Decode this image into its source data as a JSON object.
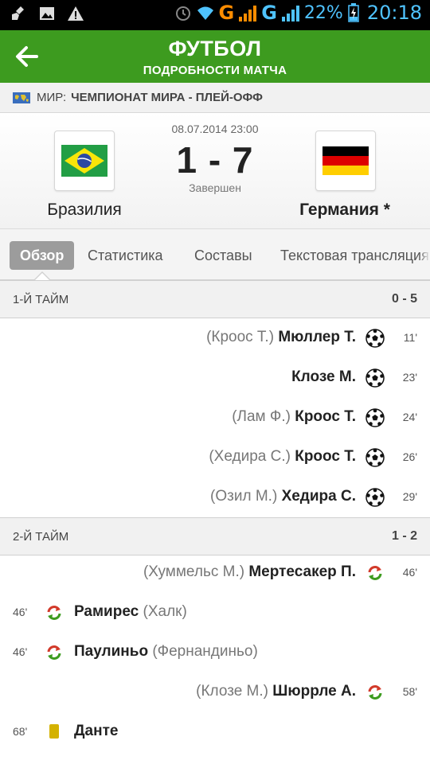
{
  "status_bar": {
    "network1": "G",
    "network2": "G",
    "battery": "22%",
    "time": "20:18"
  },
  "header": {
    "title": "ФУТБОЛ",
    "subtitle": "ПОДРОБНОСТИ МАТЧА",
    "back_icon": "arrow-left-icon"
  },
  "tournament": {
    "country": "МИР:",
    "name": "ЧЕМПИОНАТ МИРА - ПЛЕЙ-ОФФ"
  },
  "match": {
    "date": "08.07.2014 23:00",
    "score": "1 - 7",
    "status": "Завершен",
    "home": {
      "name": "Бразилия"
    },
    "away": {
      "name": "Германия *"
    }
  },
  "tabs": [
    {
      "label": "Обзор",
      "active": true
    },
    {
      "label": "Статистика",
      "active": false
    },
    {
      "label": "Составы",
      "active": false
    },
    {
      "label": "Текстовая трансляция",
      "active": false
    }
  ],
  "sections": [
    {
      "label": "1-Й ТАЙМ",
      "score": "0 - 5",
      "events": [
        {
          "side": "away",
          "type": "goal",
          "assist": "(Кроос Т.)",
          "player": "Мюллер Т.",
          "minute": "11'"
        },
        {
          "side": "away",
          "type": "goal",
          "assist": "",
          "player": "Клозе М.",
          "minute": "23'"
        },
        {
          "side": "away",
          "type": "goal",
          "assist": "(Лам Ф.)",
          "player": "Кроос Т.",
          "minute": "24'"
        },
        {
          "side": "away",
          "type": "goal",
          "assist": "(Хедира С.)",
          "player": "Кроос Т.",
          "minute": "26'"
        },
        {
          "side": "away",
          "type": "goal",
          "assist": "(Озил М.)",
          "player": "Хедира С.",
          "minute": "29'"
        }
      ]
    },
    {
      "label": "2-Й ТАЙМ",
      "score": "1 - 2",
      "events": [
        {
          "side": "away",
          "type": "substitution",
          "assist": "(Хуммельс М.)",
          "player": "Мертесакер П.",
          "minute": "46'"
        },
        {
          "side": "home",
          "type": "substitution",
          "assist": "(Халк)",
          "player": "Рамирес",
          "minute": "46'"
        },
        {
          "side": "home",
          "type": "substitution",
          "assist": "(Фернандиньо)",
          "player": "Паулиньо",
          "minute": "46'"
        },
        {
          "side": "away",
          "type": "substitution",
          "assist": "(Клозе М.)",
          "player": "Шюррле А.",
          "minute": "58'"
        },
        {
          "side": "home",
          "type": "yellow-card",
          "assist": "",
          "player": "Данте",
          "minute": "68'"
        }
      ]
    }
  ],
  "colors": {
    "appbar": "#3d9b1f",
    "accent_blue": "#4fc3ff",
    "accent_orange": "#ff8c00",
    "sub_red": "#d23a2a",
    "sub_green": "#3d9b1f",
    "yellow_card": "#d4b200"
  }
}
